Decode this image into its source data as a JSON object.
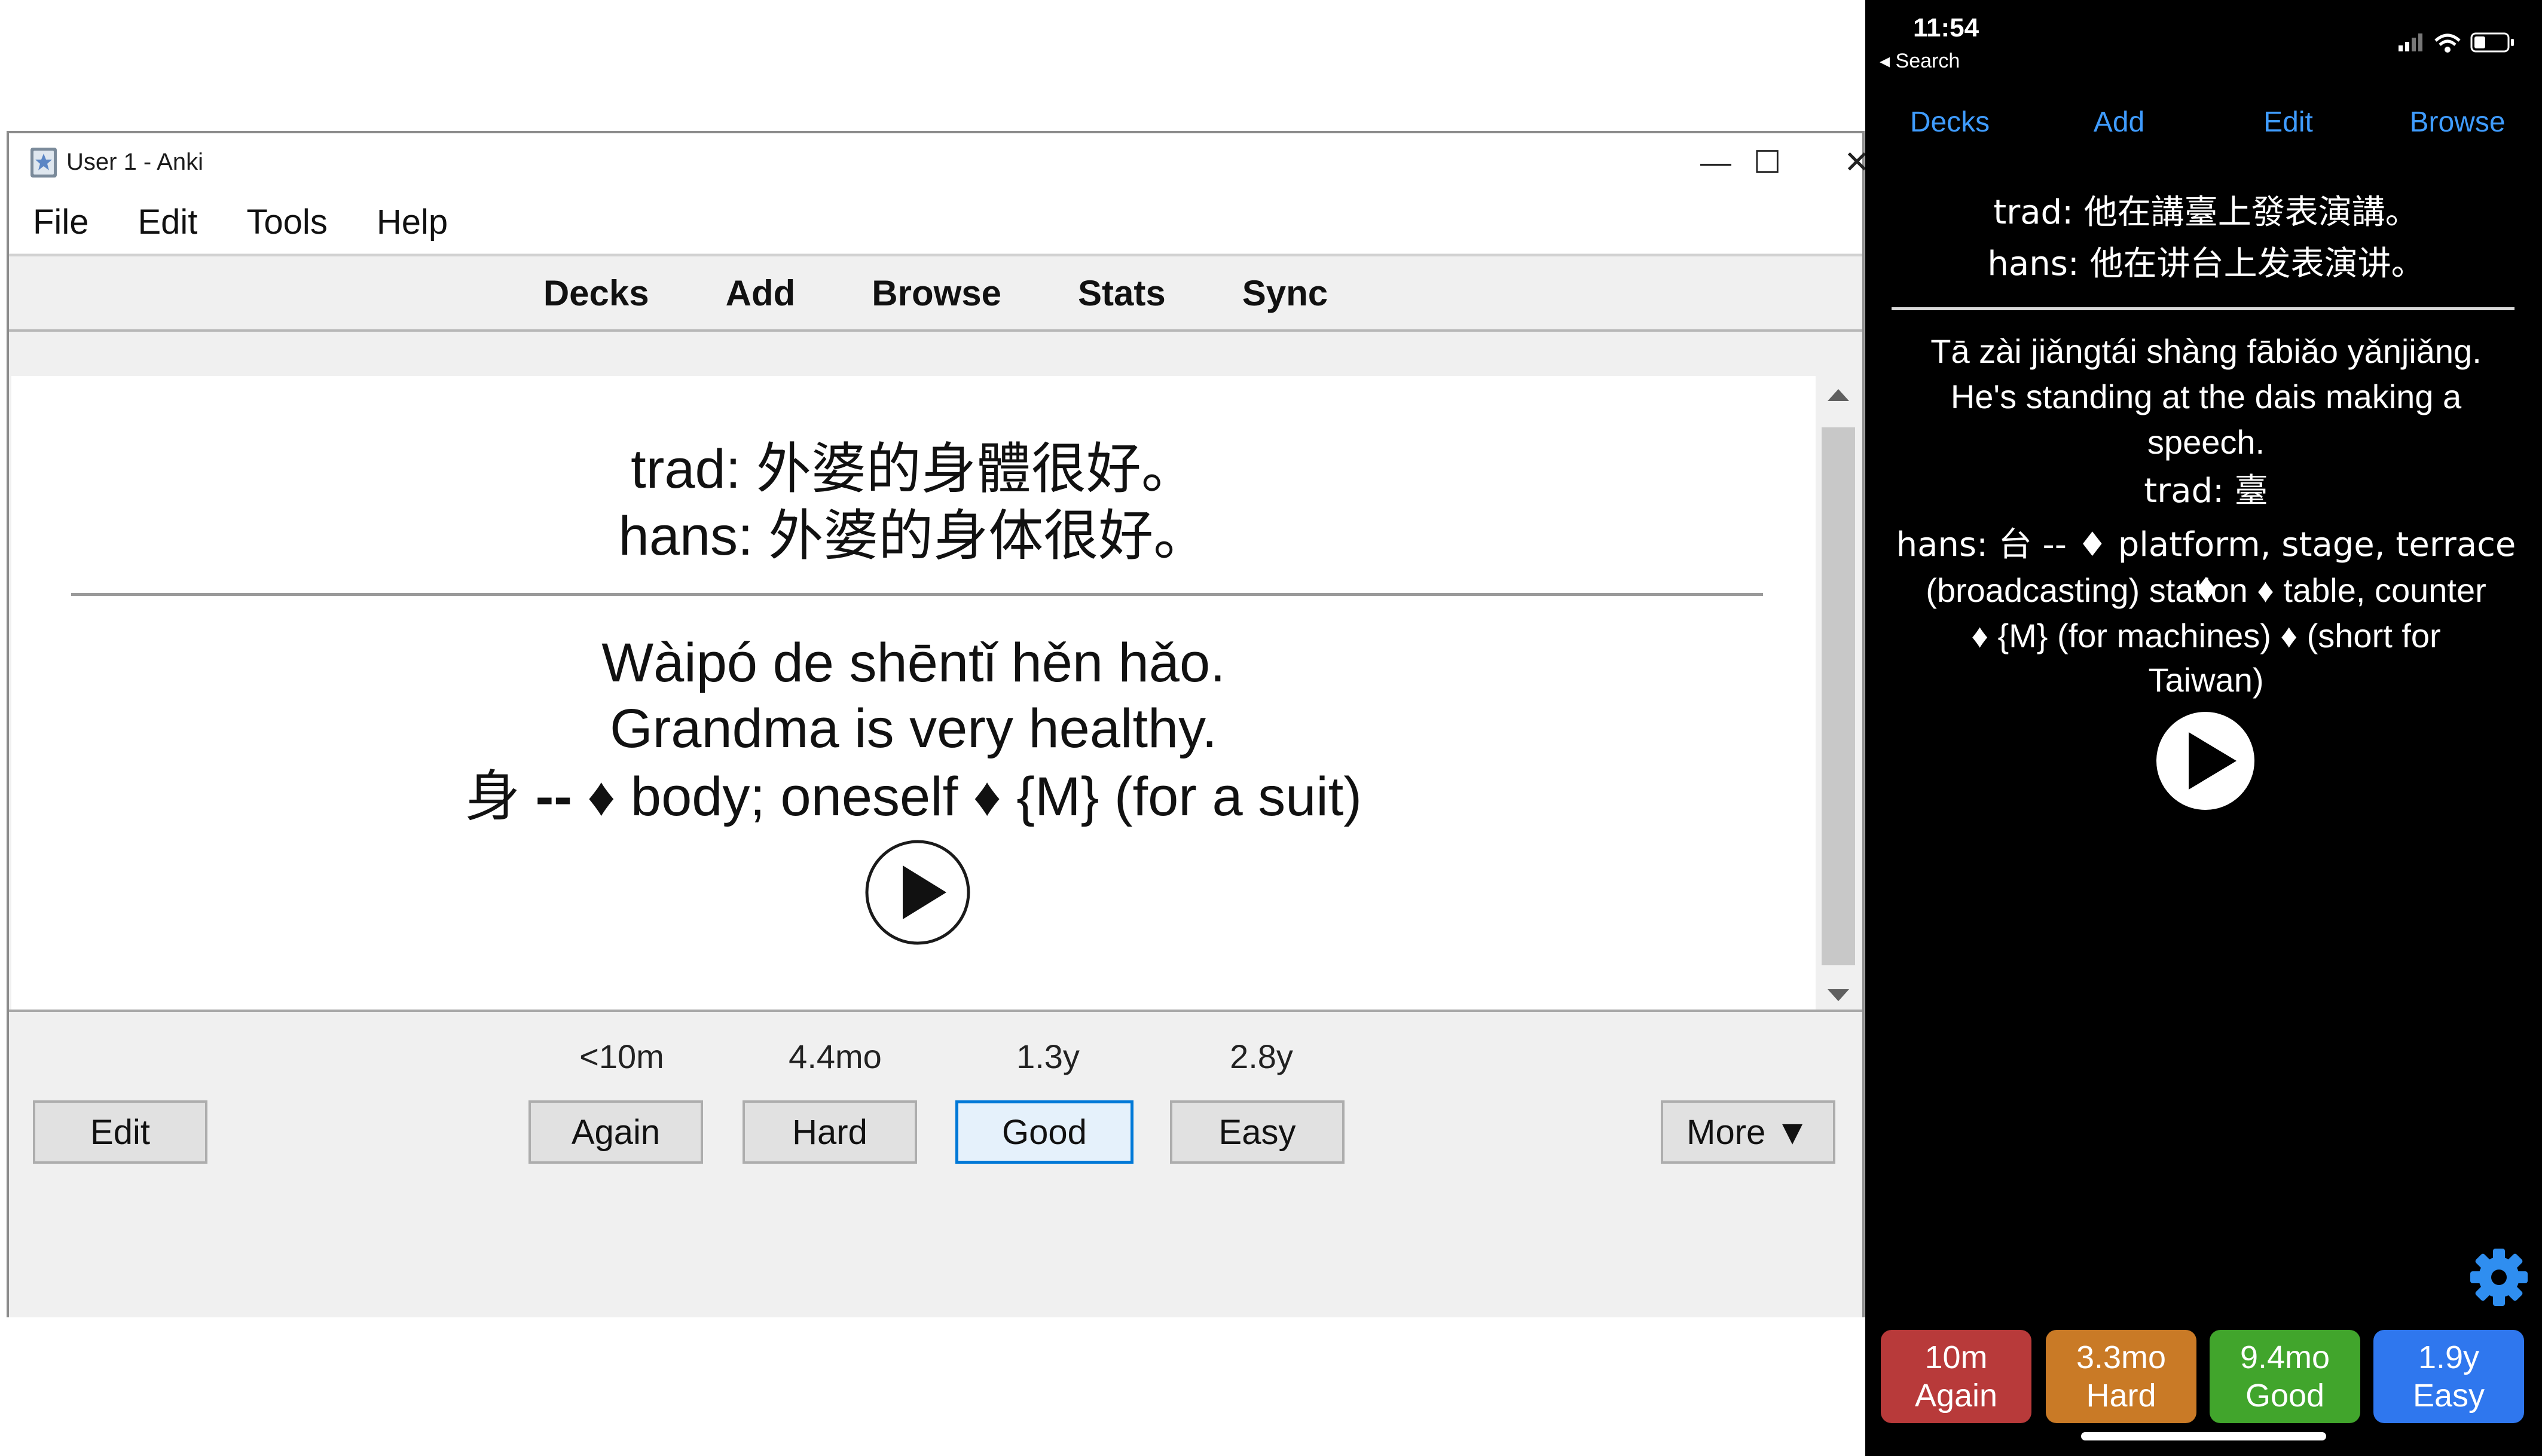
{
  "desktop": {
    "title": "User 1 - Anki",
    "window_controls": {
      "minimize": "—",
      "maximize": "☐",
      "close": "✕"
    },
    "menu": [
      "File",
      "Edit",
      "Tools",
      "Help"
    ],
    "toolbar": [
      "Decks",
      "Add",
      "Browse",
      "Stats",
      "Sync"
    ],
    "card": {
      "trad_label": "trad:",
      "trad": "外婆的身體很好。",
      "hans_label": "hans:",
      "hans": "外婆的身体很好。",
      "pinyin": "Wàipó de shēntǐ hěn hǎo.",
      "english": "Grandma is very healthy.",
      "def_char": "身",
      "def_sep": "--",
      "def_text": "♦ body; oneself ♦ {M} (for a suit)"
    },
    "intervals": {
      "again": "<10m",
      "hard": "4.4mo",
      "good": "1.3y",
      "easy": "2.8y"
    },
    "buttons": {
      "edit": "Edit",
      "again": "Again",
      "hard": "Hard",
      "good": "Good",
      "easy": "Easy",
      "more": "More ▼"
    }
  },
  "mobile": {
    "status": {
      "time": "11:54",
      "back": "◂ Search"
    },
    "nav": [
      "Decks",
      "Add",
      "Edit",
      "Browse"
    ],
    "card": {
      "trad_line": "trad: 他在講臺上發表演講。",
      "hans_line": "hans: 他在讲台上发表演讲。",
      "pinyin": "Tā zài jiǎngtái shàng fābiǎo yǎnjiǎng.",
      "english_1": "He's standing at the dais making a",
      "english_2": "speech.",
      "trad_char_line": "trad: 臺",
      "def_1": "hans: 台 -- ♦ platform, stage, terrace ♦",
      "def_2": "(broadcasting) station ♦ table, counter",
      "def_3": "♦ {M} (for machines) ♦ (short for",
      "def_4": "Taiwan)"
    },
    "answer_buttons": [
      {
        "interval": "10m",
        "label": "Again",
        "color": "#b83a3a"
      },
      {
        "interval": "3.3mo",
        "label": "Hard",
        "color": "#c97a26"
      },
      {
        "interval": "9.4mo",
        "label": "Good",
        "color": "#41a52c"
      },
      {
        "interval": "1.9y",
        "label": "Easy",
        "color": "#2f77ee"
      }
    ],
    "accent": "#3f9cff"
  }
}
